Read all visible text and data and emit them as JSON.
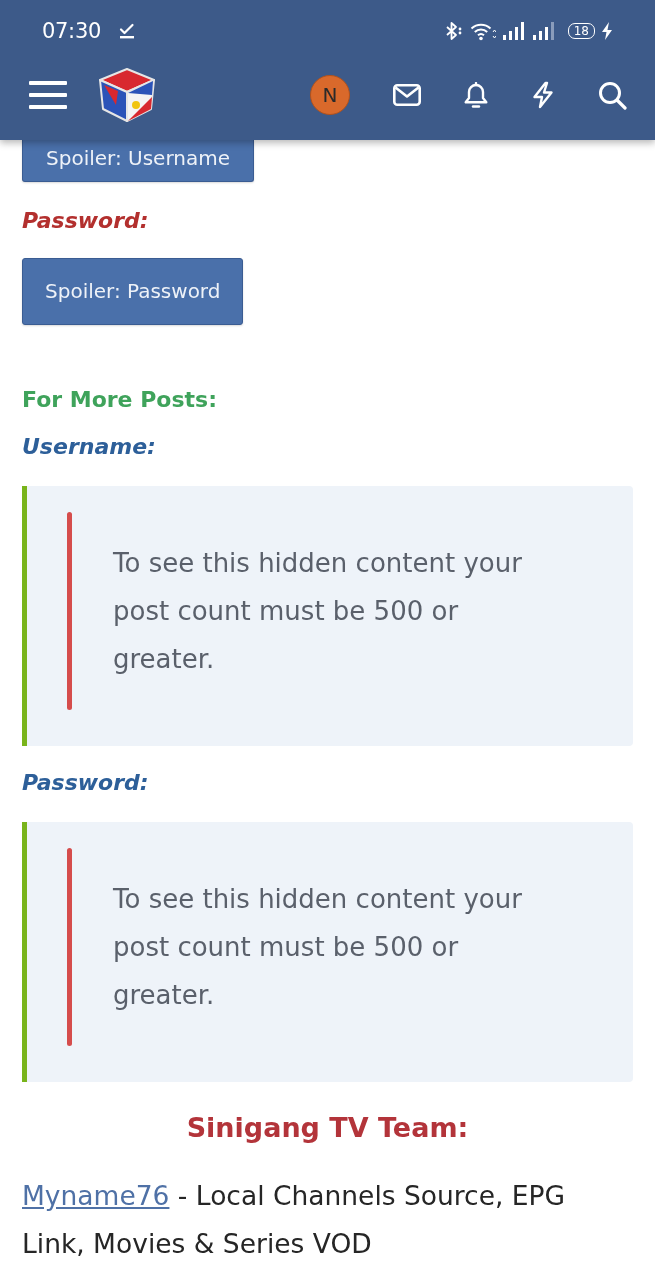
{
  "status_bar": {
    "time": "07:30",
    "battery": "18"
  },
  "app_bar": {
    "avatar": "N"
  },
  "post": [
    {
      "items": [
        {
          "kind": "spoiler",
          "label": "Spoiler: Username"
        },
        {
          "kind": "label",
          "text": "Password:",
          "color": "#b3302e",
          "italic": true
        },
        {
          "kind": "spoiler",
          "label": "Spoiler: Password"
        }
      ]
    },
    {
      "items": [
        {
          "kind": "label",
          "text": "For More Posts:",
          "color": "#3fa35b",
          "italic": false
        },
        {
          "kind": "label",
          "text": "Username:",
          "color": "#2d5f99",
          "italic": true
        },
        {
          "kind": "hidden",
          "text": "To see this hidden content your post count must be 500 or greater."
        },
        {
          "kind": "label",
          "text": "Password:",
          "color": "#2d5f99",
          "italic": true
        },
        {
          "kind": "hidden",
          "text": "To see this hidden content your post count must be 500 or greater."
        },
        {
          "kind": "heading",
          "text": "Sinigang TV Team:"
        },
        {
          "kind": "credit",
          "link": "Myname76",
          "text": "- Local Channels Source, EPG Link, Movies & Series VOD"
        }
      ]
    }
  ]
}
